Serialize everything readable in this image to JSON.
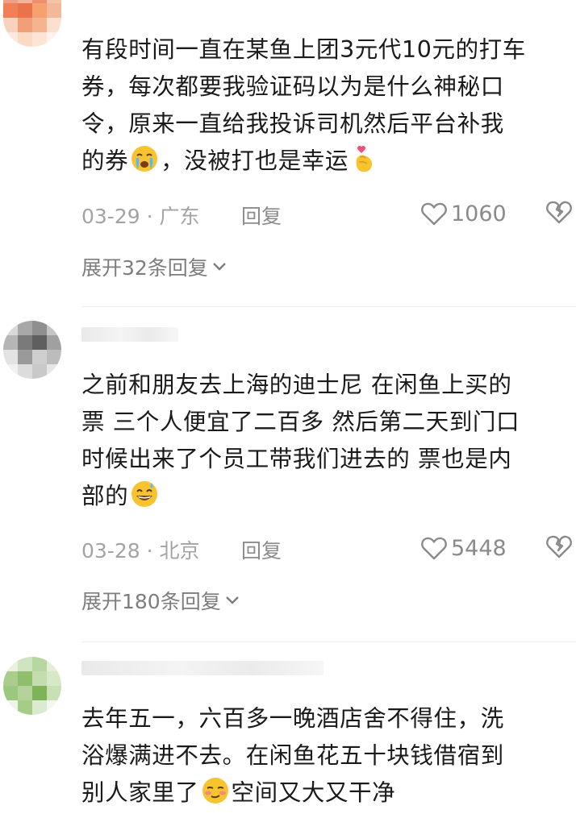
{
  "comments": [
    {
      "lines": [
        "有段时间一直在某鱼上团3元代10元的打车",
        "券，每次都要我验证码以为是什么神秘口",
        "令，原来一直给我投诉司机然后平台补我"
      ],
      "last_line_before": "的券",
      "last_line_middle": "，没被打也是幸运",
      "last_line_after": "",
      "emoji_1": "crying-face-emoji",
      "emoji_2": "finger-heart-emoji",
      "date": "03-29",
      "location": "广东",
      "separator": " · ",
      "reply_label": "回复",
      "likes": "1060",
      "expand_label": "展开32条回复"
    },
    {
      "lines": [
        "之前和朋友去上海的迪士尼 在闲鱼上买的",
        "票 三个人便宜了二百多 然后第二天到门口",
        "时候出来了个员工带我们进去的 票也是内"
      ],
      "last_line_before": "部的",
      "emoji_1": "grinning-sweat-emoji",
      "date": "03-28",
      "location": "北京",
      "separator": " · ",
      "reply_label": "回复",
      "likes": "5448",
      "expand_label": "展开180条回复"
    },
    {
      "lines": [
        "去年五一，六百多一晚酒店舍不得住，洗",
        "浴爆满进不去。在闲鱼花五十块钱借宿到"
      ],
      "last_line_before": "别人家里了",
      "last_line_after": "空间又大又干净",
      "emoji_1": "smirking-blush-emoji"
    }
  ],
  "colors": {
    "meta_gray": "#a3a3a3",
    "text_dark": "#1a1a1a",
    "icon_gray": "#8a8a8a",
    "emoji_yellow": "#f7c430",
    "heart_pink": "#f0507a"
  }
}
